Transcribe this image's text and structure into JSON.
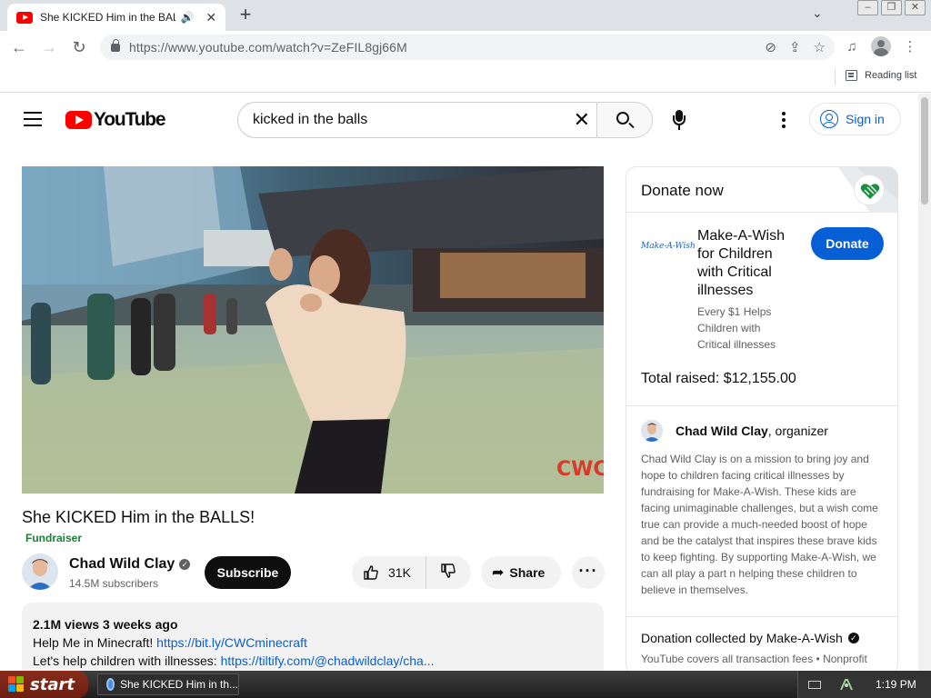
{
  "browser": {
    "tab": {
      "title": "She KICKED Him in the BALLS!",
      "favicon": "youtube-icon",
      "audio_icon": "speaker-icon"
    },
    "url": "https://www.youtube.com/watch?v=ZeFIL8gj66M",
    "bookmarks": {
      "reading_list": "Reading list"
    },
    "window_buttons": [
      "minimize",
      "restore",
      "close"
    ]
  },
  "youtube": {
    "logo_text": "YouTube",
    "search": {
      "query": "kicked in the balls"
    },
    "signin": "Sign in",
    "video": {
      "title": "She KICKED Him in the BALLS!",
      "badge": "Fundraiser",
      "channel": {
        "name": "Chad Wild Clay",
        "verified_mark": "✓",
        "subscribers": "14.5M subscribers",
        "subscribe_label": "Subscribe"
      },
      "likes": "31K",
      "share_label": "Share",
      "more_label": "···",
      "watermark": "CWC",
      "description": {
        "meta": "2.1M views  3 weeks ago",
        "line1_text": "Help Me in Minecraft! ",
        "line1_link": "https://bit.ly/CWCminecraft",
        "line2_text": "Let's help children with illnesses: ",
        "line2_link": "https://tiltify.com/@chadwildclay/cha..."
      }
    },
    "donate": {
      "header": "Donate now",
      "org_logo": "Make-A-Wish",
      "org_name": "Make-A-Wish for Children with Critical illnesses",
      "org_tagline": "Every $1 Helps Children with Critical illnesses",
      "donate_label": "Donate",
      "total_raised": "Total raised: $12,155.00",
      "organizer_name": "Chad Wild Clay",
      "organizer_role": ", organizer",
      "organizer_text": "Chad Wild Clay is on a mission to bring joy and hope to children facing critical illnesses by fundraising for Make-A-Wish. These kids are facing unimaginable challenges, but a wish come true can provide a much-needed boost of hope and be the catalyst that inspires these brave kids to keep fighting. By supporting Make-A-Wish, we can all play a part n helping these children to believe in themselves.",
      "collected_by": "Donation collected by Make-A-Wish",
      "fees": "YouTube covers all transaction fees  •  Nonprofit website"
    }
  },
  "taskbar": {
    "start_label": "start",
    "task_label": "She KICKED Him in th...",
    "clock": "1:19 PM"
  },
  "colors": {
    "youtube_red": "#ff0000",
    "link_blue": "#065fd4",
    "donate_blue": "#065fd4",
    "fundraiser_green": "#1b7d38"
  }
}
